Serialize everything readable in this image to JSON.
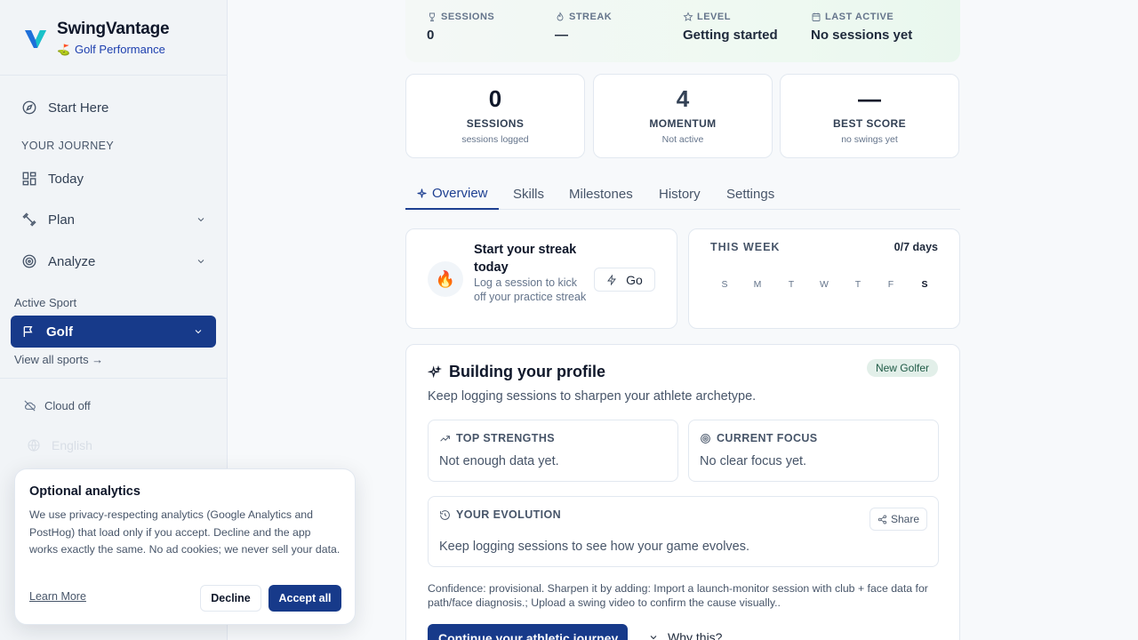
{
  "brand": {
    "name": "SwingVantage",
    "subtitle": "Golf Performance",
    "flag": "⛳"
  },
  "sidebar": {
    "start_here": "Start Here",
    "section_label": "YOUR JOURNEY",
    "items": [
      {
        "label": "Today"
      },
      {
        "label": "Plan"
      },
      {
        "label": "Analyze"
      }
    ],
    "active_sport_label": "Active Sport",
    "active_sport": "Golf",
    "view_all": "View all sports →",
    "cloud": "Cloud off",
    "language": "English"
  },
  "cookie": {
    "title": "Optional analytics",
    "body": "We use privacy-respecting analytics (Google Analytics and PostHog) that load only if you accept. Decline and the app works exactly the same. No ad cookies; we never sell your data.",
    "learn_more": "Learn More",
    "decline": "Decline",
    "accept": "Accept all"
  },
  "summary": [
    {
      "label": "SESSIONS",
      "value": "0",
      "icon": "trophy-icon"
    },
    {
      "label": "STREAK",
      "value": "—",
      "icon": "flame-icon"
    },
    {
      "label": "LEVEL",
      "value": "Getting started",
      "icon": "star-icon"
    },
    {
      "label": "LAST ACTIVE",
      "value": "No sessions yet",
      "icon": "calendar-icon"
    }
  ],
  "stats": [
    {
      "value": "0",
      "label": "SESSIONS",
      "sub": "sessions logged"
    },
    {
      "value": "4",
      "label": "MOMENTUM",
      "sub": "Not active"
    },
    {
      "value": "—",
      "label": "BEST SCORE",
      "sub": "no swings yet"
    }
  ],
  "tabs": [
    "Overview",
    "Skills",
    "Milestones",
    "History",
    "Settings"
  ],
  "streak": {
    "title": "Start your streak today",
    "subtitle": "Log a session to kick off your practice streak",
    "go": "Go",
    "emoji": "🔥"
  },
  "week": {
    "title": "THIS WEEK",
    "count": "0/7 days",
    "days": [
      "S",
      "M",
      "T",
      "W",
      "T",
      "F",
      "S"
    ]
  },
  "profile": {
    "title": "Building your profile",
    "badge": "New Golfer",
    "subtitle": "Keep logging sessions to sharpen your athlete archetype.",
    "strengths_title": "TOP STRENGTHS",
    "strengths_body": "Not enough data yet.",
    "focus_title": "CURRENT FOCUS",
    "focus_body": "No clear focus yet.",
    "evolution_title": "YOUR EVOLUTION",
    "evolution_body": "Keep logging sessions to see how your game evolves.",
    "share": "Share",
    "confidence": "Confidence: provisional. Sharpen it by adding: Import a launch-monitor session with club + face data for path/face diagnosis.; Upload a swing video to confirm the cause visually..",
    "cta": "Continue your athletic journey",
    "why": "Why this?"
  },
  "colors": {
    "primary": "#173a8a",
    "accent_tab": "#1d3f91",
    "badge_bg": "#e2efe9"
  }
}
